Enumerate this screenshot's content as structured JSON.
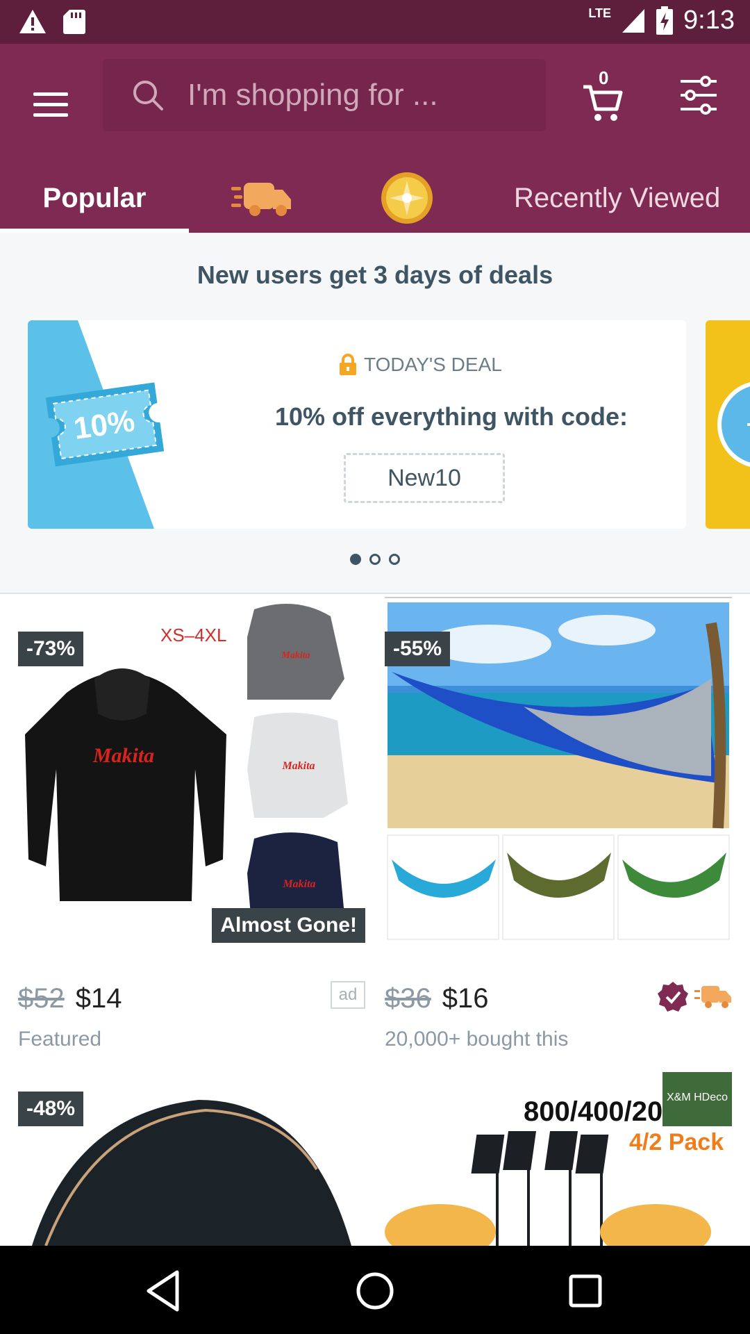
{
  "status_bar": {
    "time": "9:13",
    "network": "LTE",
    "icons": [
      "warning-icon",
      "sd-card-icon",
      "signal-icon",
      "battery-charging-icon"
    ]
  },
  "header": {
    "search_placeholder": "I'm shopping for ...",
    "cart_count": "0",
    "icons": [
      "menu-icon",
      "search-icon",
      "cart-icon",
      "filter-icon"
    ]
  },
  "tabs": [
    {
      "label": "Popular",
      "active": true
    },
    {
      "label": "",
      "icon": "fast-shipping-truck-icon"
    },
    {
      "label": "",
      "icon": "gold-coin-icon"
    },
    {
      "label": "Recently Viewed"
    }
  ],
  "deals": {
    "title": "New users get 3 days of deals",
    "label": "TODAY'S DEAL",
    "text": "10% off everything with code:",
    "code": "New10",
    "coupon_text": "10%",
    "slides": 3,
    "active_slide": 0
  },
  "products": [
    {
      "discount": "-73%",
      "image_text": "XS–4XL",
      "brand_text": "Makita",
      "badge": "Almost Gone!",
      "old_price": "$52",
      "new_price": "$14",
      "subtitle": "Featured",
      "ad": "ad"
    },
    {
      "discount": "-55%",
      "old_price": "$36",
      "new_price": "$16",
      "subtitle": "20,000+ bought this",
      "badges": [
        "verified-check-icon",
        "fast-shipping-truck-icon"
      ]
    },
    {
      "discount": "-48%"
    },
    {
      "image_text": "800/400/20",
      "image_text2": "4/2 Pack",
      "logo_text": "X&M HDeco"
    }
  ],
  "colors": {
    "status_bar": "#5e1f3d",
    "header": "#7f2a53",
    "deal_text": "#3f5563",
    "discount_badge": "#3a4347"
  }
}
